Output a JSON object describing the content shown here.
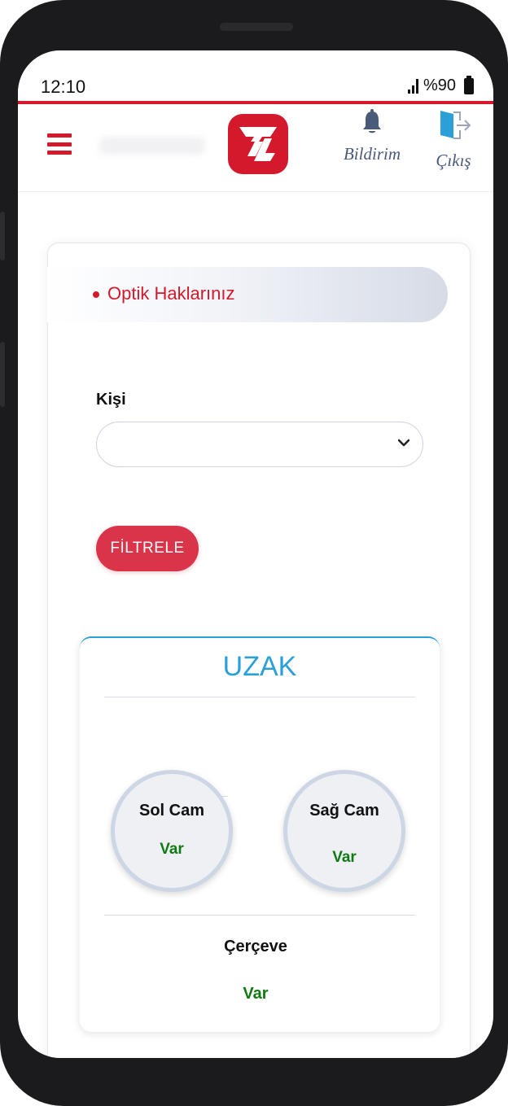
{
  "status_bar": {
    "time": "12:10",
    "battery": "%90"
  },
  "header": {
    "notifications_label": "Bildirim",
    "logout_label": "Çıkış"
  },
  "section": {
    "title": "Optik Haklarınız"
  },
  "filter": {
    "person_label": "Kişi",
    "person_selected": "",
    "button_label": "FİLTRELE"
  },
  "uzak": {
    "title": "UZAK",
    "left_lens_label": "Sol Cam",
    "left_lens_value": "Var",
    "right_lens_label": "Sağ Cam",
    "right_lens_value": "Var",
    "frame_label": "Çerçeve",
    "frame_value": "Var"
  },
  "colors": {
    "accent": "#d3192b",
    "info": "#2a9fd8",
    "available": "#0f7a12"
  },
  "icons": [
    "hamburger-icon",
    "app-logo",
    "bell-icon",
    "exit-icon",
    "chevron-down-icon"
  ]
}
